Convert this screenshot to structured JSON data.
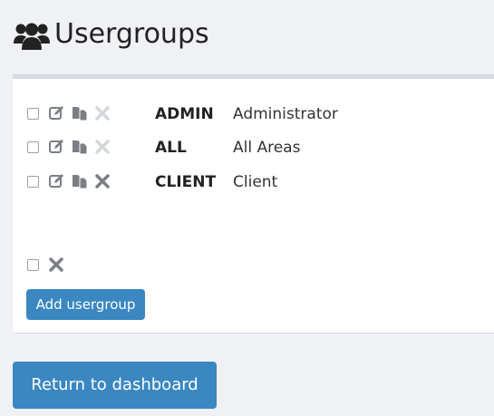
{
  "header": {
    "title": "Usergroups",
    "icon": "users-icon"
  },
  "usergroups": [
    {
      "code": "ADMIN",
      "description": "Administrator",
      "delete_enabled": false
    },
    {
      "code": "ALL",
      "description": "All Areas",
      "delete_enabled": false
    },
    {
      "code": "CLIENT",
      "description": "Client",
      "delete_enabled": true
    }
  ],
  "actions": {
    "add_label": "Add usergroup",
    "return_label": "Return to dashboard"
  },
  "colors": {
    "button": "#3a87c2",
    "icon_active": "#7b7f84",
    "icon_disabled": "#d3d6da",
    "background": "#f0f1f5"
  }
}
